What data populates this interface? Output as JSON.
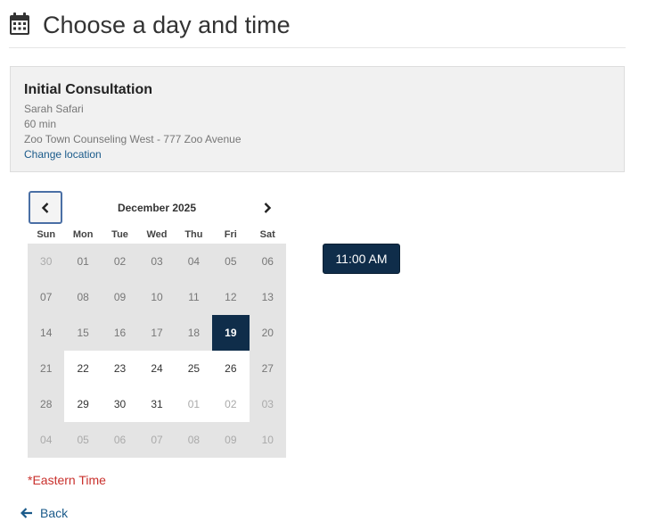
{
  "page": {
    "title": "Choose a day and time"
  },
  "appointment": {
    "name": "Initial Consultation",
    "provider": "Sarah Safari",
    "duration": "60 min",
    "location": "Zoo Town Counseling West - 777 Zoo Avenue",
    "change_location_label": "Change location"
  },
  "calendar": {
    "month_label": "December 2025",
    "weekdays": [
      "Sun",
      "Mon",
      "Tue",
      "Wed",
      "Thu",
      "Fri",
      "Sat"
    ],
    "weeks": [
      [
        {
          "d": "30",
          "s": "other"
        },
        {
          "d": "01",
          "s": "past"
        },
        {
          "d": "02",
          "s": "past"
        },
        {
          "d": "03",
          "s": "past"
        },
        {
          "d": "04",
          "s": "past"
        },
        {
          "d": "05",
          "s": "past"
        },
        {
          "d": "06",
          "s": "past"
        }
      ],
      [
        {
          "d": "07",
          "s": "past"
        },
        {
          "d": "08",
          "s": "past"
        },
        {
          "d": "09",
          "s": "past"
        },
        {
          "d": "10",
          "s": "past"
        },
        {
          "d": "11",
          "s": "past"
        },
        {
          "d": "12",
          "s": "past"
        },
        {
          "d": "13",
          "s": "past"
        }
      ],
      [
        {
          "d": "14",
          "s": "past"
        },
        {
          "d": "15",
          "s": "past"
        },
        {
          "d": "16",
          "s": "past"
        },
        {
          "d": "17",
          "s": "past"
        },
        {
          "d": "18",
          "s": "past"
        },
        {
          "d": "19",
          "s": "selected"
        },
        {
          "d": "20",
          "s": "past"
        }
      ],
      [
        {
          "d": "21",
          "s": "past"
        },
        {
          "d": "22",
          "s": "avail"
        },
        {
          "d": "23",
          "s": "avail"
        },
        {
          "d": "24",
          "s": "avail"
        },
        {
          "d": "25",
          "s": "avail"
        },
        {
          "d": "26",
          "s": "avail"
        },
        {
          "d": "27",
          "s": "past"
        }
      ],
      [
        {
          "d": "28",
          "s": "past"
        },
        {
          "d": "29",
          "s": "avail"
        },
        {
          "d": "30",
          "s": "avail"
        },
        {
          "d": "31",
          "s": "avail"
        },
        {
          "d": "01",
          "s": "avail-other"
        },
        {
          "d": "02",
          "s": "avail-other"
        },
        {
          "d": "03",
          "s": "other"
        }
      ],
      [
        {
          "d": "04",
          "s": "other"
        },
        {
          "d": "05",
          "s": "other"
        },
        {
          "d": "06",
          "s": "other"
        },
        {
          "d": "07",
          "s": "other"
        },
        {
          "d": "08",
          "s": "other"
        },
        {
          "d": "09",
          "s": "other"
        },
        {
          "d": "10",
          "s": "other"
        }
      ]
    ]
  },
  "times": [
    "11:00 AM"
  ],
  "timezone_label": "*Eastern Time",
  "back_label": "Back",
  "icons": {
    "calendar": "calendar-icon",
    "prev": "chevron-left-icon",
    "next": "chevron-right-icon",
    "back": "arrow-left-icon"
  },
  "colors": {
    "primary": "#0f2d4a",
    "link": "#1a5a8a",
    "timezone": "#c9302c"
  }
}
